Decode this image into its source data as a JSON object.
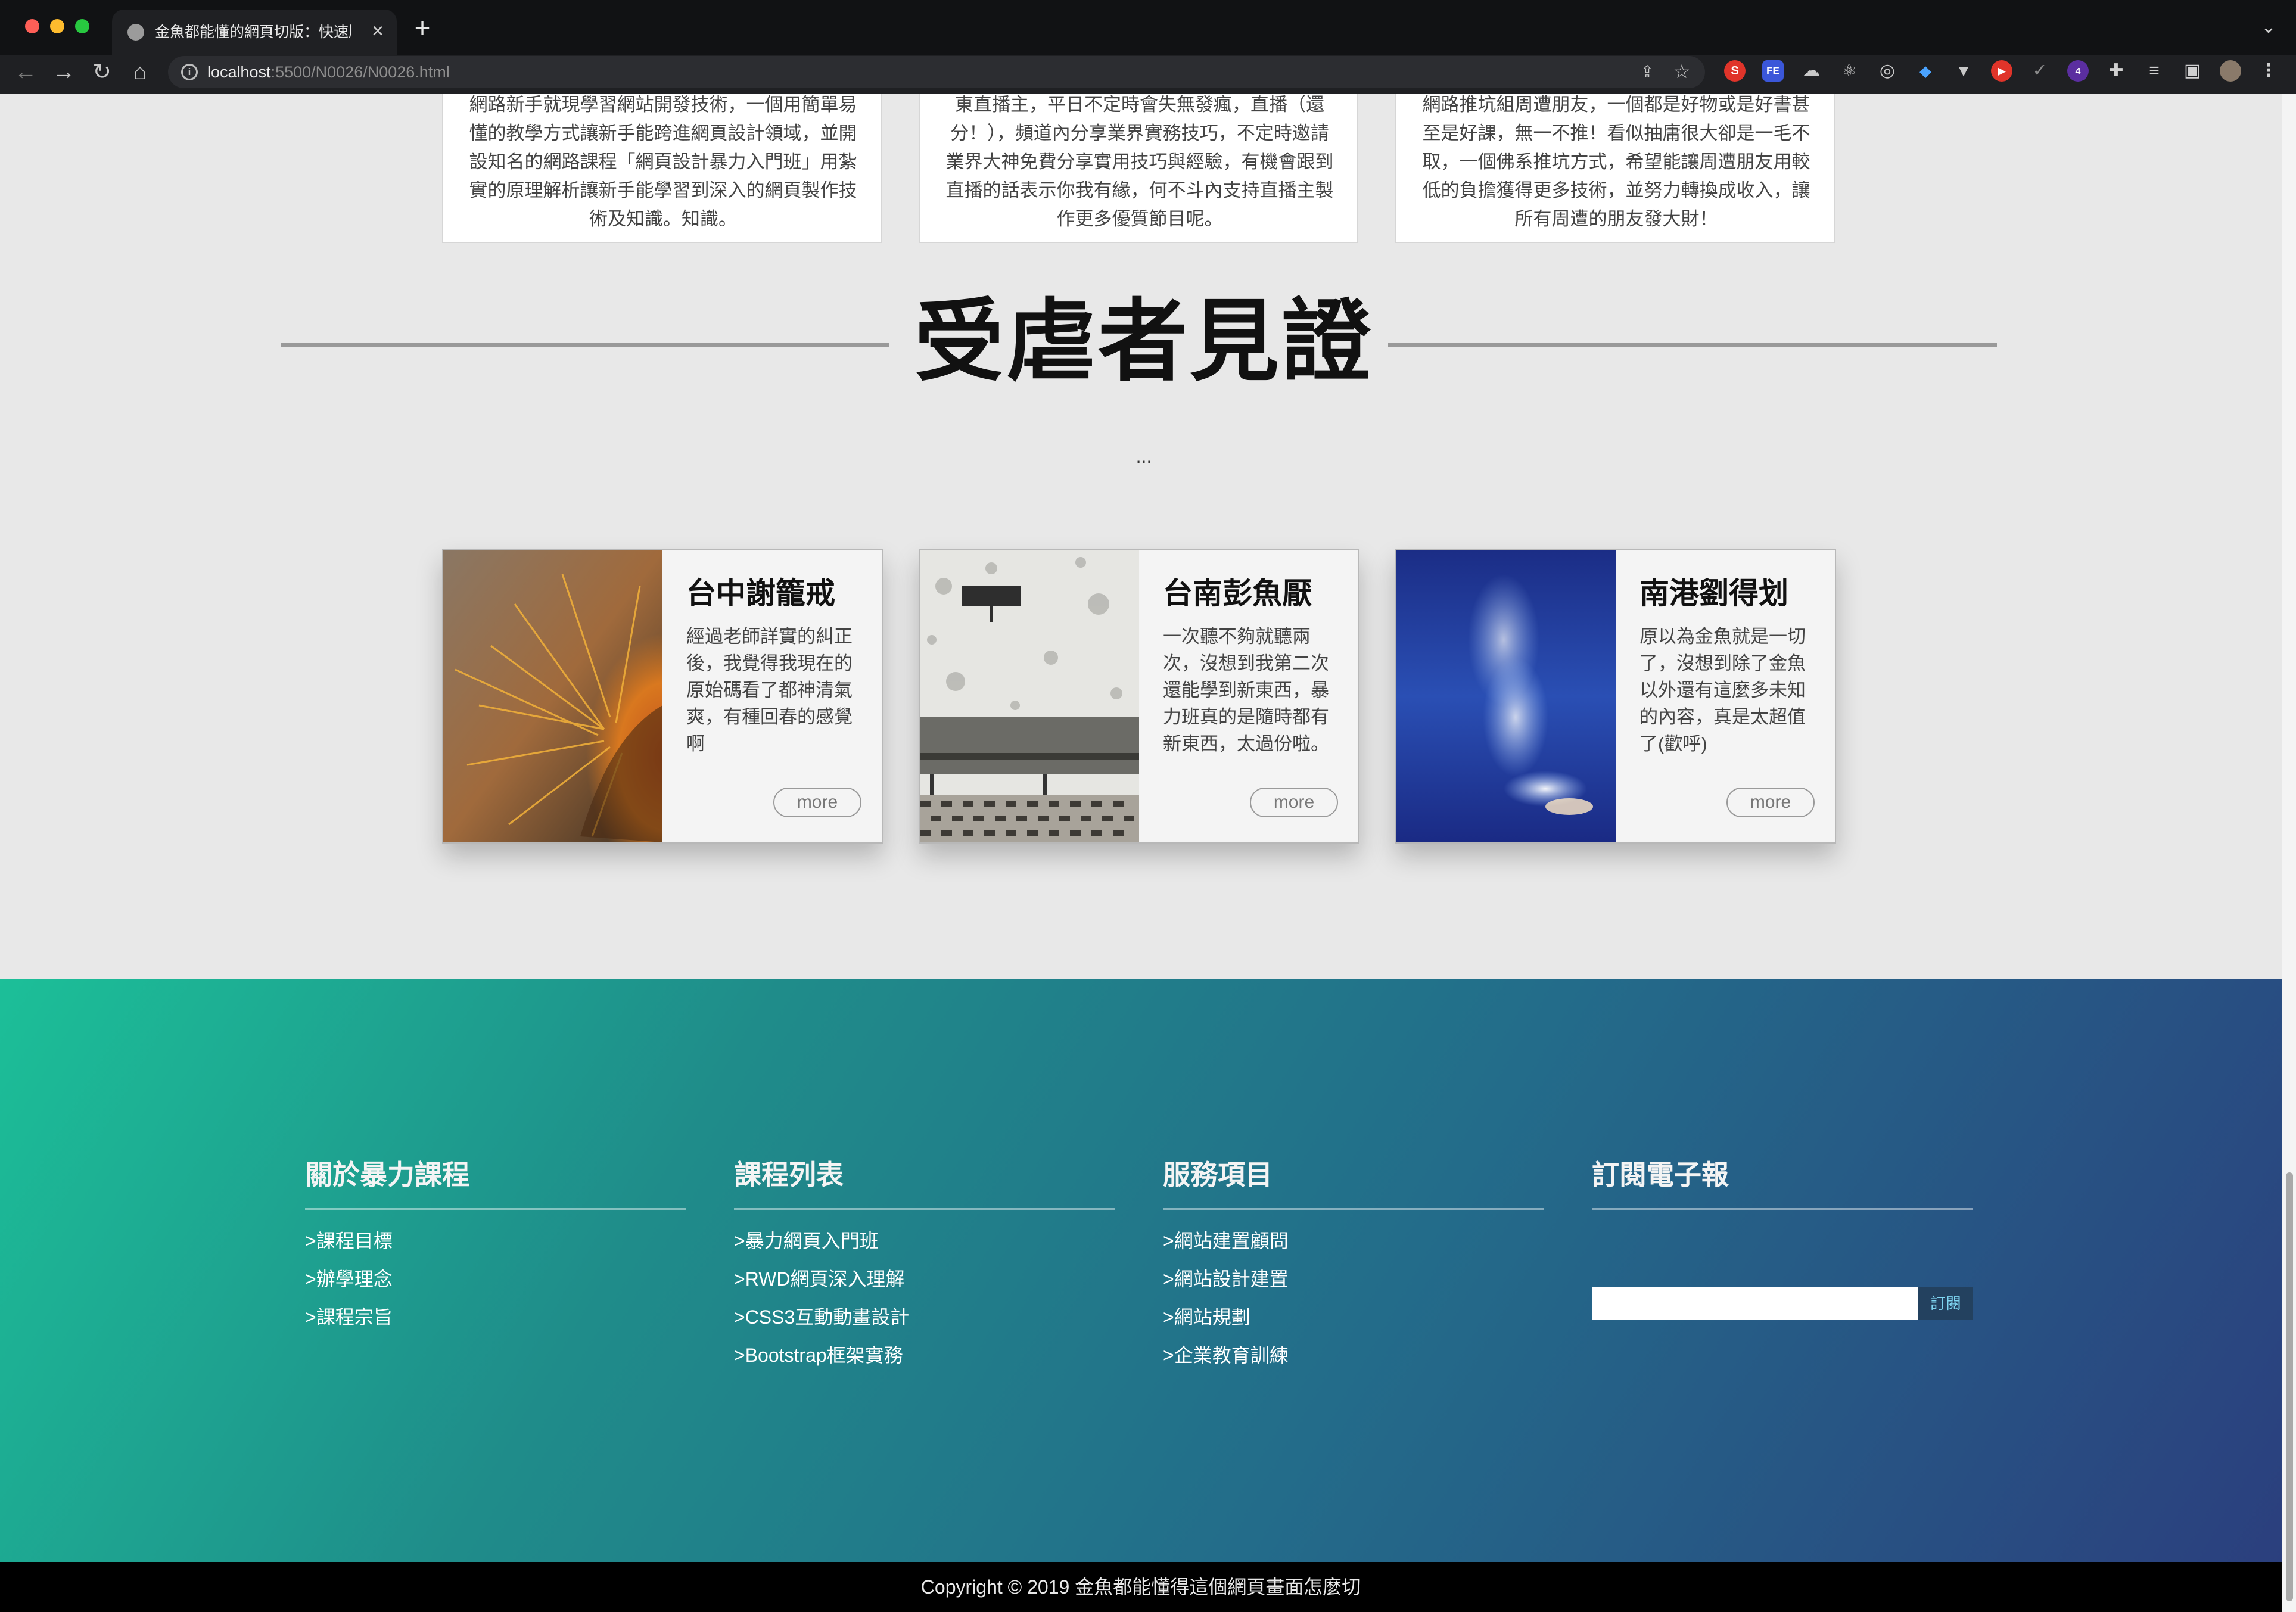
{
  "browser": {
    "tab_title": "金魚都能懂的網頁切版：快速版面",
    "url_host": "localhost",
    "url_path": ":5500/N0026/N0026.html",
    "ext_badge_count": "4"
  },
  "features": [
    {
      "text": "網路新手就現學習網站開發技術，一個用簡單易懂的教學方式讓新手能跨進網頁設計領域，並開設知名的網路課程「網頁設計暴力入門班」用紮實的原理解析讓新手能學習到深入的網頁製作技術及知識。知識。"
    },
    {
      "text": "東直播主，平日不定時會失無發瘋，直播（還分！），頻道內分享業界實務技巧，不定時邀請業界大神免費分享實用技巧與經驗，有機會跟到直播的話表示你我有緣，何不斗內支持直播主製作更多優質節目呢。"
    },
    {
      "text": "網路推坑組周遭朋友，一個都是好物或是好書甚至是好課，無一不推！看似抽庸很大卻是一毛不取，一個佛系推坑方式，希望能讓周遭朋友用較低的負擔獲得更多技術，並努力轉換成收入，讓所有周遭的朋友發大財！"
    }
  ],
  "testimonials_section": {
    "title": "受虐者見證",
    "subtitle": "..."
  },
  "testimonials": [
    {
      "name": "台中謝籠戒",
      "text": "經過老師詳實的糾正後，我覺得我現在的原始碼看了都神清氣爽，有種回春的感覺啊",
      "more": "more"
    },
    {
      "name": "台南彭魚厭",
      "text": "一次聽不夠就聽兩次，沒想到我第二次還能學到新東西，暴力班真的是隨時都有新東西，太過份啦。",
      "more": "more"
    },
    {
      "name": "南港劉得划",
      "text": "原以為金魚就是一切了，沒想到除了金魚以外還有這麼多未知的內容，真是太超值了(歡呼)",
      "more": "more"
    }
  ],
  "footer": {
    "about": {
      "heading": "關於暴力課程",
      "links": [
        ">課程目標",
        ">辦學理念",
        ">課程宗旨"
      ]
    },
    "courses": {
      "heading": "課程列表",
      "links": [
        ">暴力網頁入門班",
        ">RWD網頁深入理解",
        ">CSS3互動動畫設計",
        ">Bootstrap框架實務"
      ]
    },
    "services": {
      "heading": "服務項目",
      "links": [
        ">網站建置顧問",
        ">網站設計建置",
        ">網站規劃",
        ">企業教育訓練"
      ]
    },
    "newsletter": {
      "heading": "訂閱電子報",
      "input_value": "",
      "button_label": "訂閱"
    },
    "copyright": "Copyright © 2019 金魚都能懂得這個網頁畫面怎麼切"
  },
  "colors": {
    "footer_gradient_start": "#1cbf98",
    "footer_gradient_end": "#2b3f7e",
    "page_background": "#e8e8e8",
    "subscribe_button": "#23415f"
  },
  "icons": [
    "back-arrow-icon",
    "forward-arrow-icon",
    "reload-icon",
    "home-icon",
    "info-icon",
    "share-icon",
    "star-icon",
    "extensions-puzzle-icon",
    "close-icon",
    "plus-icon"
  ]
}
